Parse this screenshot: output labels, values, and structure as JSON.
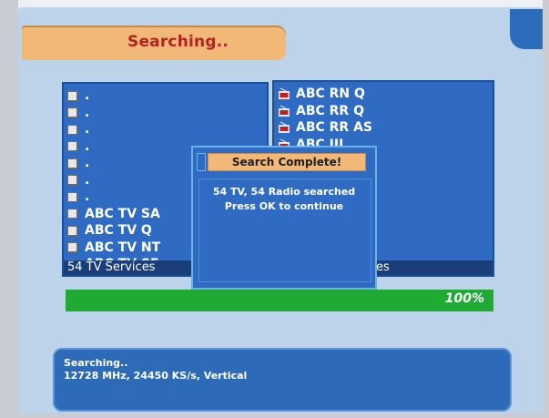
{
  "header": {
    "title": "Searching.."
  },
  "tv_panel": {
    "items": [
      {
        "label": "."
      },
      {
        "label": "."
      },
      {
        "label": "."
      },
      {
        "label": "."
      },
      {
        "label": "."
      },
      {
        "label": "."
      },
      {
        "label": "."
      },
      {
        "label": "ABC TV SA"
      },
      {
        "label": "ABC TV Q"
      },
      {
        "label": "ABC TV NT"
      },
      {
        "label": "ABC TV SE"
      }
    ],
    "footer": "54 TV Services"
  },
  "radio_panel": {
    "items": [
      {
        "label": "ABC RN Q"
      },
      {
        "label": "ABC RR Q"
      },
      {
        "label": "ABC RR AS"
      },
      {
        "label": "ABC JJJ"
      }
    ],
    "footer": "es"
  },
  "progress": {
    "value": 1.0,
    "label": "100%"
  },
  "dialog": {
    "title": "Search Complete!",
    "message_line1": "54 TV, 54 Radio searched",
    "message_line2": "Press OK to continue"
  },
  "status": {
    "line1": "Searching..",
    "line2": "12728 MHz, 24450 KS/s, Vertical"
  },
  "colors": {
    "panel_blue": "#2f6bc2",
    "accent_orange": "#f1b877",
    "title_red": "#b32121",
    "progress_green": "#1faa34"
  },
  "icons": {
    "tv": "tv-channel-icon",
    "radio": "radio-channel-icon"
  }
}
